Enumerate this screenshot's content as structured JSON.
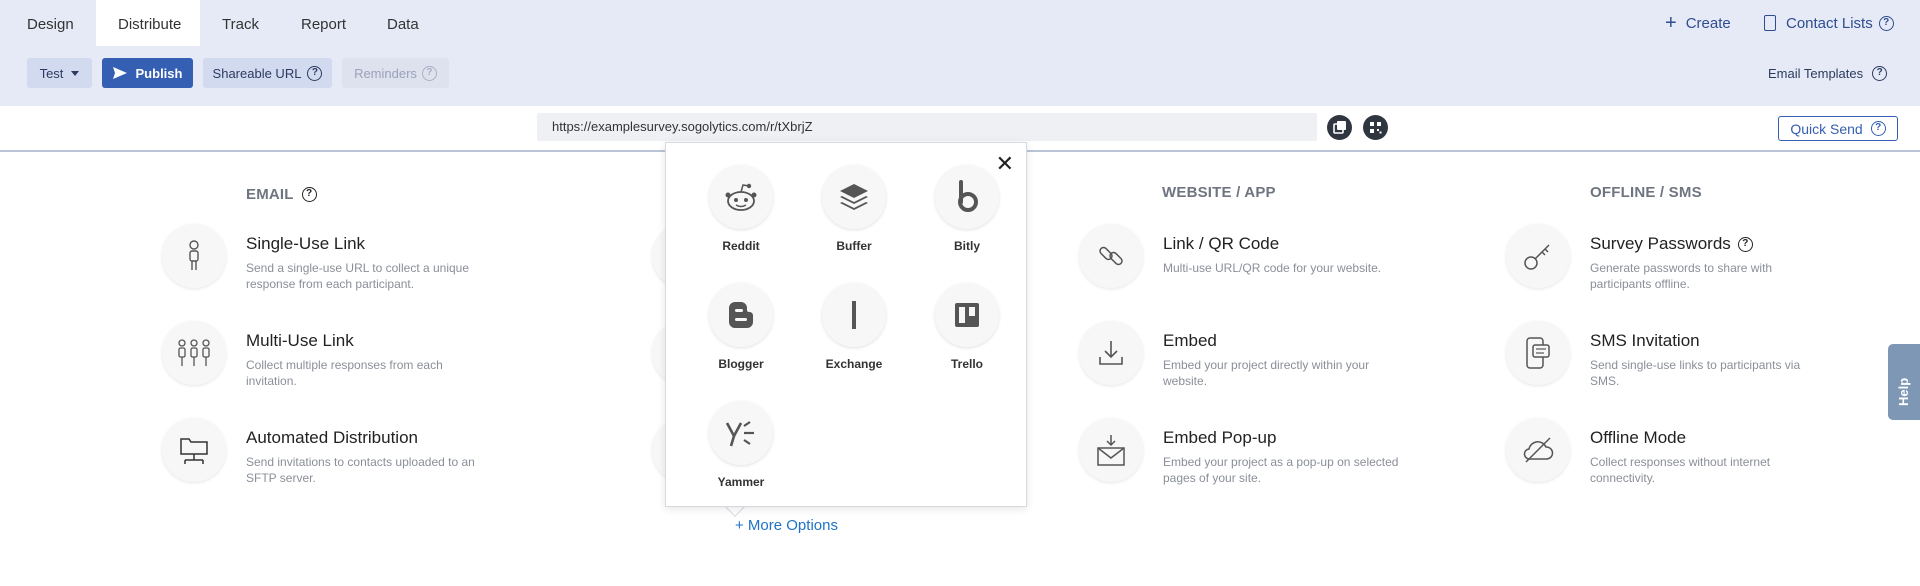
{
  "tabs": [
    {
      "label": "Design",
      "active": false
    },
    {
      "label": "Distribute",
      "active": true
    },
    {
      "label": "Track",
      "active": false
    },
    {
      "label": "Report",
      "active": false
    },
    {
      "label": "Data",
      "active": false
    }
  ],
  "header": {
    "create_label": "Create",
    "contact_lists_label": "Contact Lists"
  },
  "toolbar": {
    "test_label": "Test",
    "publish_label": "Publish",
    "shareable_url_label": "Shareable URL",
    "reminders_label": "Reminders",
    "email_templates_label": "Email Templates"
  },
  "url_bar": {
    "url": "https://examplesurvey.sogolytics.com/r/tXbrjZ",
    "quick_send_label": "Quick Send"
  },
  "sections": {
    "email": {
      "title": "EMAIL",
      "items": [
        {
          "title": "Single-Use Link",
          "desc": "Send a single-use URL to collect a unique response from each participant."
        },
        {
          "title": "Multi-Use Link",
          "desc": "Collect multiple responses from each invitation."
        },
        {
          "title": "Automated Distribution",
          "desc": "Send invitations to contacts uploaded to an SFTP server."
        }
      ]
    },
    "website": {
      "title": "WEBSITE / APP",
      "items": [
        {
          "title": "Link / QR Code",
          "desc": "Multi-use URL/QR code for your website."
        },
        {
          "title": "Embed",
          "desc": "Embed your project directly within your website."
        },
        {
          "title": "Embed Pop-up",
          "desc": "Embed your project as a pop-up on selected pages of your site."
        }
      ]
    },
    "offline": {
      "title": "OFFLINE / SMS",
      "items": [
        {
          "title": "Survey Passwords",
          "desc": "Generate passwords to share with participants offline."
        },
        {
          "title": "SMS Invitation",
          "desc": "Send single-use links to participants via SMS."
        },
        {
          "title": "Offline Mode",
          "desc": "Collect responses without internet connectivity."
        }
      ]
    }
  },
  "popup": {
    "close_symbol": "✕",
    "items": [
      {
        "label": "Reddit",
        "icon": "reddit-icon"
      },
      {
        "label": "Buffer",
        "icon": "buffer-icon"
      },
      {
        "label": "Bitly",
        "icon": "bitly-icon"
      },
      {
        "label": "Blogger",
        "icon": "blogger-icon"
      },
      {
        "label": "Exchange",
        "icon": "exchange-icon"
      },
      {
        "label": "Trello",
        "icon": "trello-icon"
      },
      {
        "label": "Yammer",
        "icon": "yammer-icon"
      }
    ]
  },
  "more_options_label": "+ More Options",
  "help_tab_label": "Help",
  "colors": {
    "accent": "#355fb3",
    "link": "#1f72c9",
    "tabbar": "#e6eaf6",
    "help_tab": "#7d97b4"
  }
}
